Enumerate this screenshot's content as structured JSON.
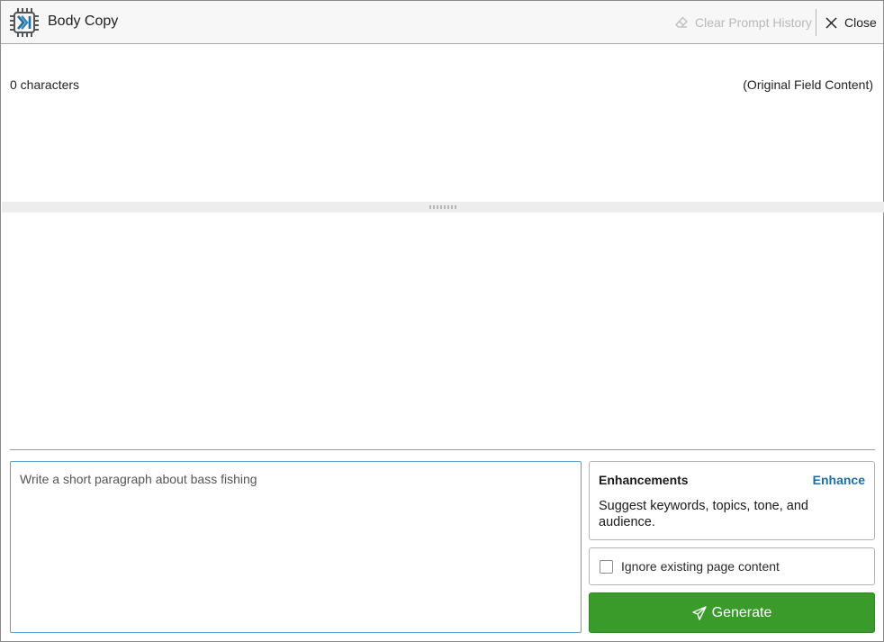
{
  "header": {
    "title": "Body Copy",
    "clear_label": "Clear Prompt History",
    "close_label": "Close",
    "logo_icon": "ai-chip-logo-icon"
  },
  "content": {
    "char_count": "0 characters",
    "original_label": "(Original Field Content)"
  },
  "prompt": {
    "value": "Write a short paragraph about bass fishing"
  },
  "enhancements": {
    "title": "Enhancements",
    "link": "Enhance",
    "description": "Suggest keywords, topics, tone, and audience."
  },
  "options": {
    "ignore_label": "Ignore existing page content",
    "ignore_checked": false
  },
  "actions": {
    "generate_label": "Generate"
  },
  "colors": {
    "accent": "#1d6fa5",
    "generate": "#3a9a2a",
    "prompt_border": "#5aa2c8"
  }
}
